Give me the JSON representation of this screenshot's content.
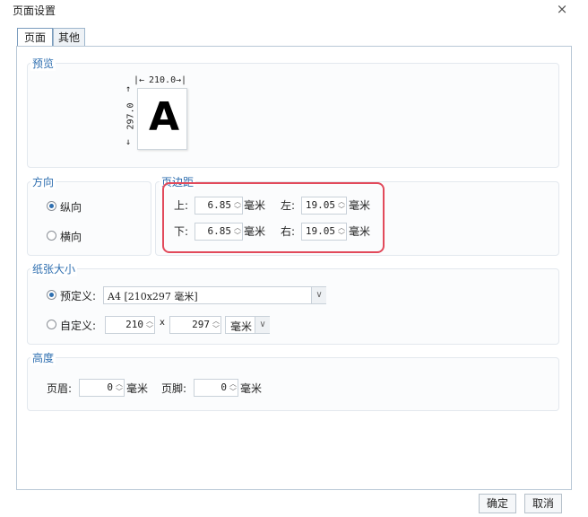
{
  "window": {
    "title": "页面设置",
    "close_icon": "×"
  },
  "tabs": [
    {
      "label": "页面",
      "active": true
    },
    {
      "label": "其他",
      "active": false
    }
  ],
  "preview": {
    "title": "预览",
    "width_label": "210.0",
    "height_label": "297.0",
    "letter": "A",
    "width_left_arrow": "|←",
    "width_right_arrow": "→|",
    "height_top_arrow": "↑",
    "height_bottom_arrow": "↓"
  },
  "orientation": {
    "title": "方向",
    "options": [
      {
        "label": "纵向",
        "selected": true
      },
      {
        "label": "横向",
        "selected": false
      }
    ]
  },
  "margins": {
    "title": "页边距",
    "top": {
      "label": "上:",
      "value": "6.85",
      "unit": "毫米"
    },
    "left": {
      "label": "左:",
      "value": "19.05",
      "unit": "毫米"
    },
    "bottom": {
      "label": "下:",
      "value": "6.85",
      "unit": "毫米"
    },
    "right": {
      "label": "右:",
      "value": "19.05",
      "unit": "毫米"
    },
    "highlight_color": "#e24a5b"
  },
  "paper_size": {
    "title": "纸张大小",
    "predefined": {
      "label": "预定义:",
      "selected": true,
      "value": "A4 [210x297 毫米]"
    },
    "custom": {
      "label": "自定义:",
      "selected": false,
      "width": "210",
      "times": "x",
      "height": "297",
      "unit": "毫米"
    }
  },
  "height": {
    "title": "高度",
    "header": {
      "label": "页眉:",
      "value": "0",
      "unit": "毫米"
    },
    "footer": {
      "label": "页脚:",
      "value": "0",
      "unit": "毫米"
    }
  },
  "buttons": {
    "ok": "确定",
    "cancel": "取消"
  },
  "colors": {
    "accent": "#2f6fb0",
    "highlight": "#e24a5b"
  }
}
